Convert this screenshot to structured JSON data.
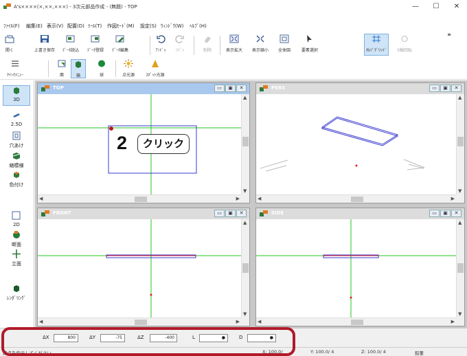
{
  "window": {
    "title": "A's××××(×,××,×××) - 3次元部品作成 - (無題) - TOP",
    "minimize": "—",
    "maximize": "☐",
    "close": "✕"
  },
  "menu": [
    "ﾌｧｲﾙ(F)",
    "編集(E)",
    "表示(V)",
    "配置(D)",
    "ﾂｰﾙ(T)",
    "作図ﾓｰﾄﾞ(M)",
    "設定(S)",
    "ｳｨﾝﾄﾞｳ(W)",
    "ﾍﾙﾌﾟ(H)"
  ],
  "toolbar1": {
    "open": "開く",
    "save_overwrite": "上書き保存",
    "part_load": "ﾃﾞｰﾀ読込",
    "part_register": "ﾃﾞｰﾀ登録",
    "part_edit": "ﾃﾞｰﾀ編集",
    "undo": "ｱﾝﾄﾞｩ",
    "redo": "ﾘﾄﾞｩ",
    "delete": "削除",
    "zoom_in": "表示拡大",
    "zoom_out": "表示縮小",
    "fit_all": "全体図",
    "select": "要素選択",
    "ortho_grid": "ｵﾙｿﾞｸﾞﾘｯﾄﾞ",
    "x_rotate": "X軸回転",
    "more": "»"
  },
  "toolbar2": {
    "quick_menu": "ｸｲｯｸﾒﾆｭｰ",
    "face": "面",
    "box": "箱",
    "sphere": "球",
    "point_light": "点光源",
    "spot_light": "ｽﾎﾟｯﾄ光源"
  },
  "palette": [
    {
      "label": "3D",
      "icon": "3d-icon",
      "active": true
    },
    {
      "label": "2.5D",
      "icon": "2-5d-icon",
      "active": false
    },
    {
      "label": "穴あけ",
      "icon": "hole-icon",
      "active": false
    },
    {
      "label": "縮模様",
      "icon": "pattern-icon",
      "active": false
    },
    {
      "label": "色付け",
      "icon": "color-icon",
      "active": false
    },
    {
      "label": "2D",
      "icon": "2d-icon",
      "active": false
    },
    {
      "label": "断面",
      "icon": "section-icon",
      "active": false
    },
    {
      "label": "立面",
      "icon": "elevation-icon",
      "active": false
    },
    {
      "label": "ﾚﾝﾀﾞﾘﾝｸﾞ",
      "icon": "render-icon",
      "active": false
    }
  ],
  "viewports": {
    "top": {
      "name": "TOP",
      "active": true
    },
    "pers": {
      "name": "PERS",
      "active": false
    },
    "front": {
      "name": "FRONT",
      "active": false
    },
    "side": {
      "name": "SIDE",
      "active": false
    },
    "btn_min": "▭",
    "btn_max": "▣",
    "btn_close": "✕"
  },
  "coords": {
    "dx_label": "ΔX",
    "dx_value": "800",
    "dy_label": "ΔY",
    "dy_value": "-75",
    "dz_label": "ΔZ",
    "dz_value": "-400",
    "l_label": "L",
    "l_value": "●",
    "d_label": "D",
    "d_value": "●"
  },
  "status": {
    "message": "終点を指示してください。",
    "x": "X: 100.0/",
    "y": "Y: 100.0/ 4",
    "z": "Z: 100.0/ 4",
    "mode": "鉛筆"
  },
  "annotation": {
    "step": "2",
    "action": "クリック"
  },
  "colors": {
    "axis_green": "#22c422",
    "box_blue": "#3a3acf",
    "origin_red": "#e02020",
    "highlight_red": "#b01a2a",
    "active_tab": "#a9c8ee"
  }
}
